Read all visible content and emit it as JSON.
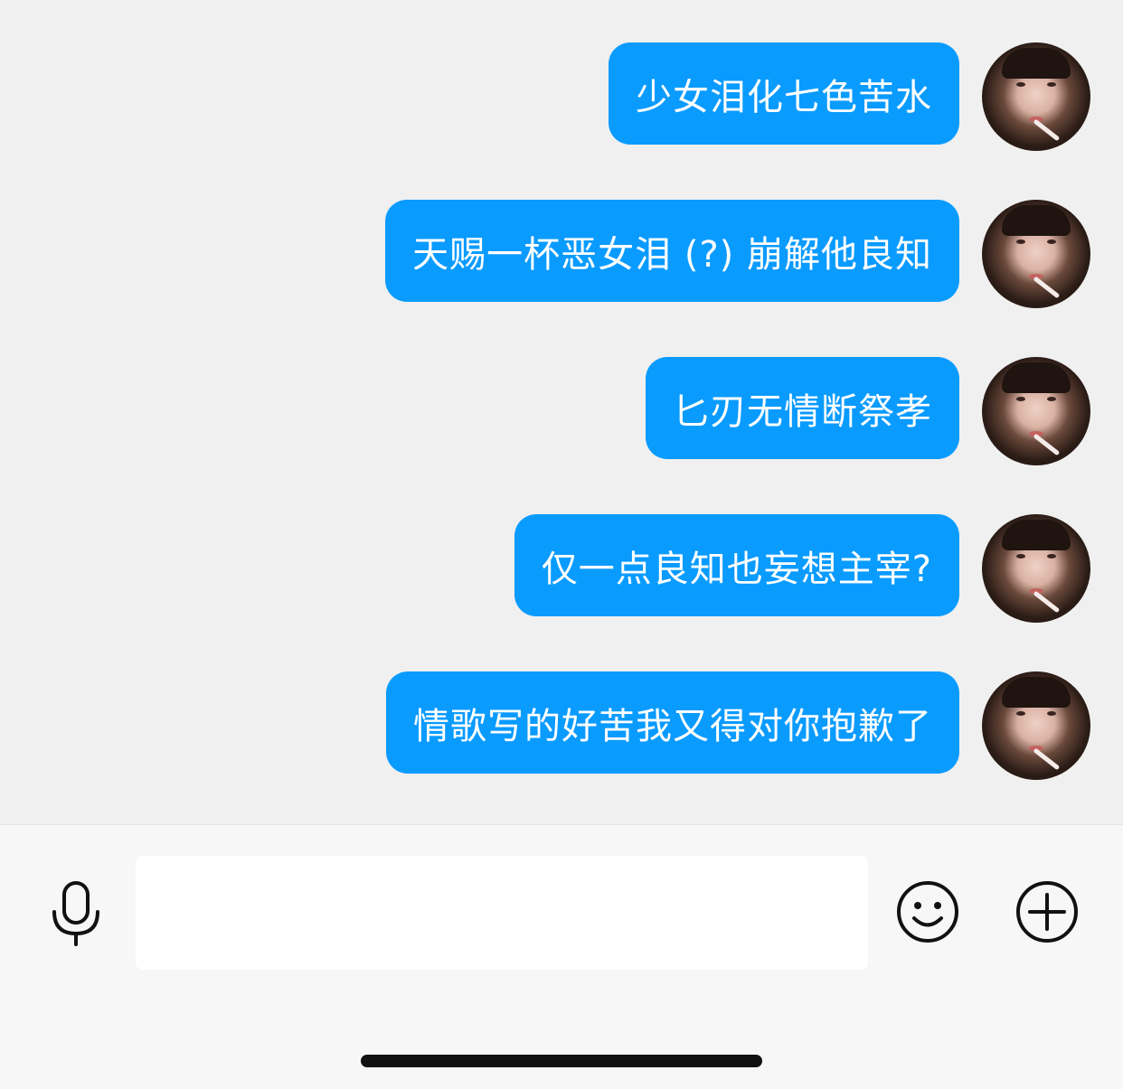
{
  "messages": [
    {
      "text": "少女泪化七色苦水",
      "sender": "me"
    },
    {
      "text": "天赐一杯恶女泪 (?) 崩解他良知",
      "sender": "me"
    },
    {
      "text": "匕刃无情断祭孝",
      "sender": "me"
    },
    {
      "text": "仅一点良知也妄想主宰?",
      "sender": "me"
    },
    {
      "text": "情歌写的好苦我又得对你抱歉了",
      "sender": "me"
    }
  ],
  "composer": {
    "input_value": "",
    "input_placeholder": "",
    "mic_icon": "microphone-icon",
    "emoji_icon": "smiley-icon",
    "plus_icon": "plus-circle-icon"
  },
  "colors": {
    "bubble": "#0a9bff",
    "bubble_text": "#ffffff",
    "chat_bg": "#f0f0f0",
    "composer_bg": "#f7f7f7"
  }
}
